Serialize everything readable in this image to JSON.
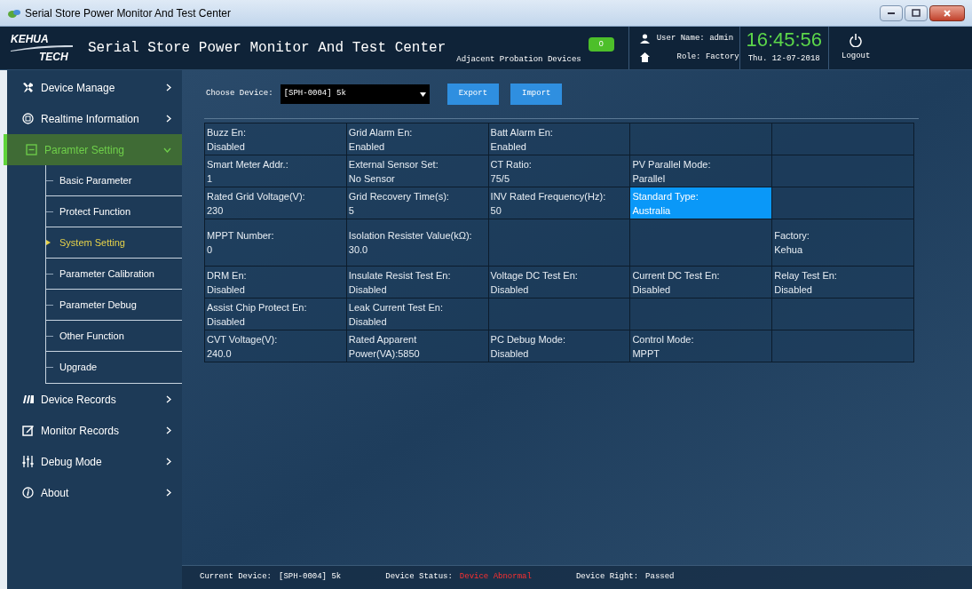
{
  "window": {
    "title": "Serial Store Power Monitor And Test Center"
  },
  "header": {
    "logo_top": "KEHUA",
    "logo_bottom": "TECH",
    "title": "Serial Store Power Monitor And Test Center",
    "adjacent_label": "Adjacent Probation Devices",
    "adjacent_count": "0",
    "user": "User Name: admin",
    "role": "Role: Factory",
    "time": "16:45:56",
    "date": "Thu. 12-07-2018",
    "logout": "Logout"
  },
  "sidebar": {
    "items": [
      {
        "label": "Device Manage",
        "selected": false,
        "expanded": false
      },
      {
        "label": "Realtime Information",
        "selected": false,
        "expanded": false
      },
      {
        "label": "Paramter Setting",
        "selected": true,
        "expanded": true,
        "children": [
          {
            "label": "Basic Parameter",
            "selected": false
          },
          {
            "label": "Protect Function",
            "selected": false
          },
          {
            "label": "System Setting",
            "selected": true
          },
          {
            "label": "Parameter Calibration",
            "selected": false
          },
          {
            "label": "Parameter Debug",
            "selected": false
          },
          {
            "label": "Other Function",
            "selected": false
          },
          {
            "label": "Upgrade",
            "selected": false
          }
        ]
      },
      {
        "label": "Device Records",
        "selected": false,
        "expanded": false
      },
      {
        "label": "Monitor Records",
        "selected": false,
        "expanded": false
      },
      {
        "label": "Debug Mode",
        "selected": false,
        "expanded": false
      },
      {
        "label": "About",
        "selected": false,
        "expanded": false
      }
    ]
  },
  "toolbar": {
    "device_label": "Choose Device:",
    "device_value": "[SPH-0004] 5k",
    "buttons": [
      "Export",
      "Import"
    ]
  },
  "table": {
    "rows": [
      [
        {
          "label": "Buzz En:",
          "value": "Disabled",
          "selected": false
        },
        {
          "label": "Grid Alarm En:",
          "value": "Enabled",
          "selected": false
        },
        {
          "label": "Batt Alarm En:",
          "value": "Enabled",
          "selected": false
        },
        {
          "selected": false
        },
        {
          "selected": false
        }
      ],
      [
        {
          "label": "Smart Meter Addr.:",
          "value": "1",
          "selected": false
        },
        {
          "label": "External Sensor Set:",
          "value": "No Sensor",
          "selected": false
        },
        {
          "label": "CT Ratio:",
          "value": "75/5",
          "selected": false
        },
        {
          "label": "PV Parallel Mode:",
          "value": "Parallel",
          "selected": false
        },
        {
          "selected": false
        }
      ],
      [
        {
          "label": "Rated Grid Voltage(V):",
          "value": "230",
          "selected": false
        },
        {
          "label": "Grid Recovery Time(s):",
          "value": "5",
          "selected": false
        },
        {
          "label": "INV Rated Frequency(Hz):",
          "value": "50",
          "selected": false
        },
        {
          "label": "Standard Type:",
          "value": "Australia",
          "selected": true
        },
        {
          "selected": false
        }
      ],
      [
        {
          "label": "MPPT Number:",
          "value": "0",
          "selected": false
        },
        {
          "label": "Isolation Resister Value(kΩ):",
          "value": "30.0",
          "selected": false
        },
        {
          "selected": false
        },
        {
          "selected": false
        },
        {
          "label": "Factory:",
          "value": "Kehua",
          "selected": false
        }
      ],
      [
        {
          "label": "DRM En:",
          "value": "Disabled",
          "selected": false
        },
        {
          "label": "Insulate Resist Test En:",
          "value": "Disabled",
          "selected": false
        },
        {
          "label": "Voltage DC Test En:",
          "value": "Disabled",
          "selected": false
        },
        {
          "label": "Current DC Test En:",
          "value": "Disabled",
          "selected": false
        },
        {
          "label": "Relay Test En:",
          "value": "Disabled",
          "selected": false
        }
      ],
      [
        {
          "label": "Assist Chip Protect En:",
          "value": "Disabled",
          "selected": false
        },
        {
          "label": "Leak Current Test En:",
          "value": "Disabled",
          "selected": false
        },
        {
          "selected": false
        },
        {
          "selected": false
        },
        {
          "selected": false
        }
      ],
      [
        {
          "label": "CVT Voltage(V):",
          "value": "240.0",
          "selected": false
        },
        {
          "label": "Rated Apparent Power(VA):5850",
          "selected": false
        },
        {
          "label": "PC Debug Mode:",
          "value": "Disabled",
          "selected": false
        },
        {
          "label": "Control Mode:",
          "value": "MPPT",
          "selected": false
        },
        {
          "selected": false
        }
      ]
    ]
  },
  "status_bar": [
    {
      "label": "Current Device:",
      "value": "[SPH-0004] 5k",
      "kind": "normal"
    },
    {
      "label": "Device Status:",
      "value": "Device Abnormal",
      "kind": "alert"
    },
    {
      "label": "Device Right:",
      "value": "Passed",
      "kind": "normal"
    }
  ]
}
